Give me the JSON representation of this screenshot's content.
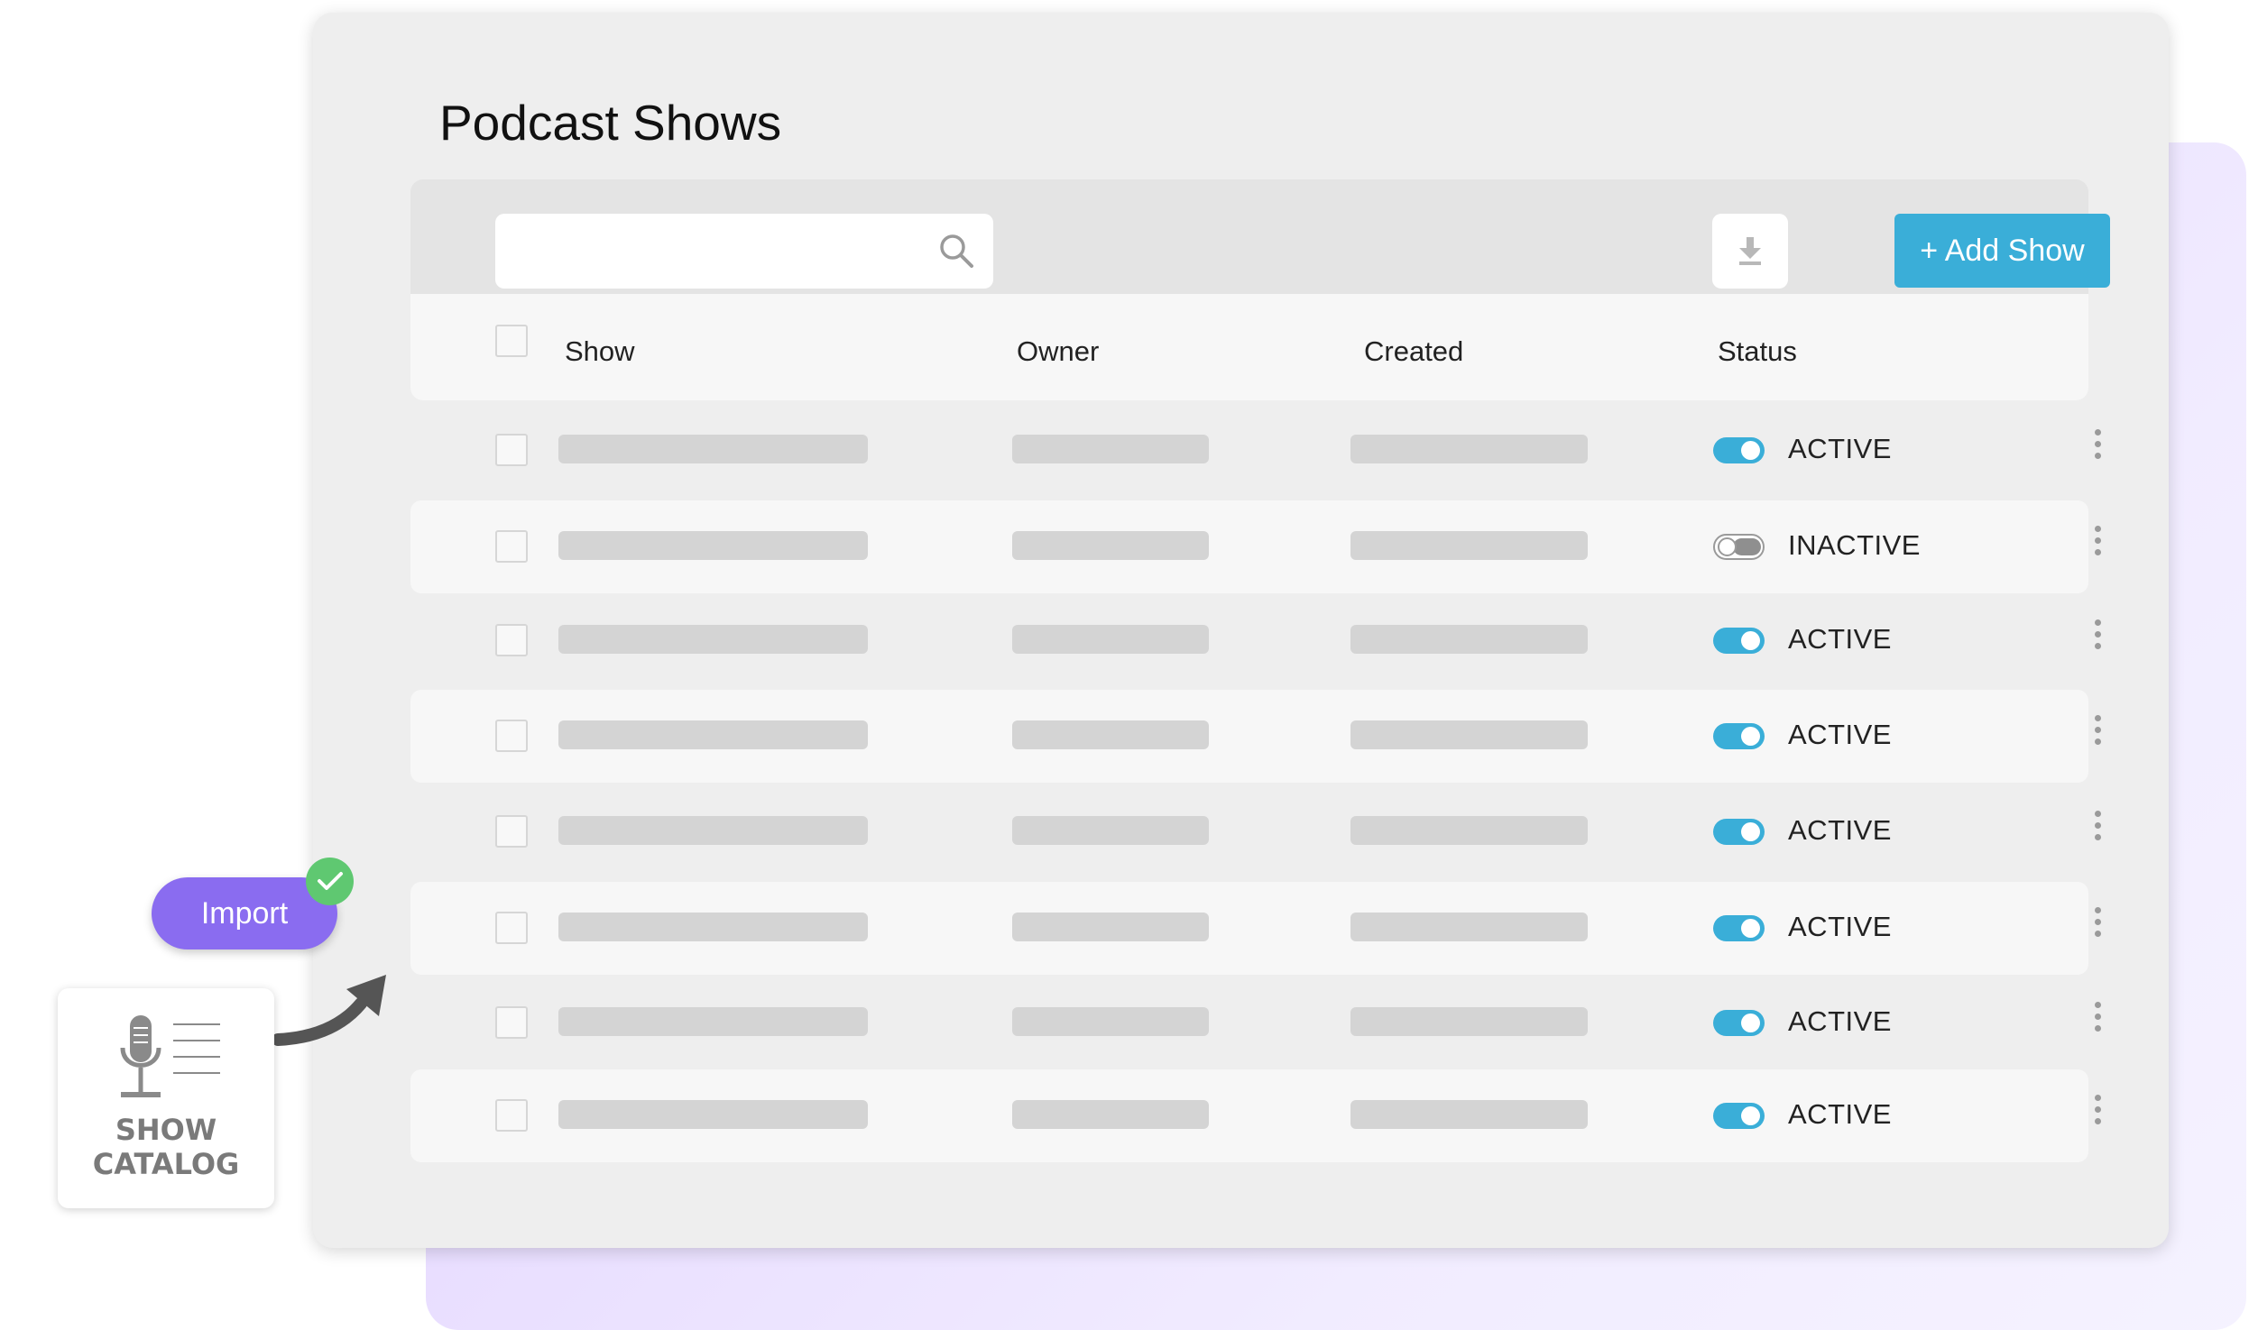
{
  "page": {
    "title": "Podcast Shows"
  },
  "toolbar": {
    "search_placeholder": "",
    "add_label": "+ Add Show"
  },
  "table": {
    "columns": [
      "Show",
      "Owner",
      "Created",
      "Status"
    ],
    "rows": [
      {
        "status": "ACTIVE",
        "enabled": true
      },
      {
        "status": "INACTIVE",
        "enabled": false
      },
      {
        "status": "ACTIVE",
        "enabled": true
      },
      {
        "status": "ACTIVE",
        "enabled": true
      },
      {
        "status": "ACTIVE",
        "enabled": true
      },
      {
        "status": "ACTIVE",
        "enabled": true
      },
      {
        "status": "ACTIVE",
        "enabled": true
      },
      {
        "status": "ACTIVE",
        "enabled": true
      }
    ]
  },
  "import": {
    "label": "Import"
  },
  "catalog": {
    "line1": "SHOW",
    "line2": "CATALOG"
  },
  "colors": {
    "accent": "#3aaed8",
    "import": "#8a6cf0",
    "success": "#5fc871"
  },
  "icons": {
    "search": "search-icon",
    "download": "download-icon",
    "kebab": "more-vertical-icon",
    "check": "check-icon",
    "arrow": "curved-arrow-icon",
    "mic": "microphone-icon"
  }
}
